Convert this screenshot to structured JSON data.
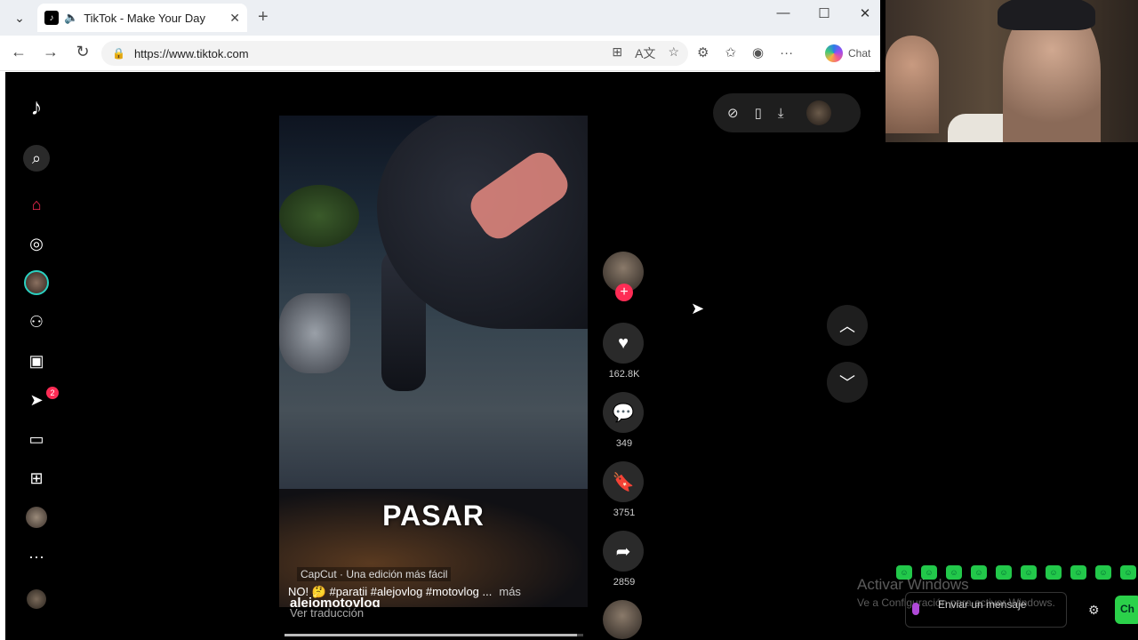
{
  "browser": {
    "tab_title": "TikTok - Make Your Day",
    "url": "https://www.tiktok.com",
    "chat_label": "Chat"
  },
  "sidebar": {
    "items": [
      {
        "name": "search-icon",
        "glyph": "⌕"
      },
      {
        "name": "home-icon",
        "glyph": "⌂"
      },
      {
        "name": "explore-icon",
        "glyph": "◎"
      },
      {
        "name": "following-avatar",
        "glyph": ""
      },
      {
        "name": "friends-icon",
        "glyph": "👥"
      },
      {
        "name": "live-icon",
        "glyph": "▣"
      },
      {
        "name": "messages-icon",
        "glyph": "➤"
      },
      {
        "name": "activity-icon",
        "glyph": "▭"
      },
      {
        "name": "upload-icon",
        "glyph": "⊞"
      },
      {
        "name": "profile-avatar",
        "glyph": ""
      },
      {
        "name": "more-icon",
        "glyph": "···"
      }
    ],
    "messages_badge": "2"
  },
  "video": {
    "caption_overlay": "PASAR",
    "capcut_label": "CapCut · Una edición más fácil",
    "username": "alejomotovlog",
    "description": "NO! 🤔 #paratii #alejovlog #motovlog ...",
    "more_label": "más",
    "translate_label": "Ver traducción",
    "progress_fraction": 0.98
  },
  "actions": {
    "likes": "162.8K",
    "comments": "349",
    "saves": "3751",
    "shares": "2859"
  },
  "stream_chat": {
    "watermark_title": "Activar Windows",
    "watermark_sub": "Ve a Configuración para activar Windows.",
    "input_placeholder": "Enviar un mensaje",
    "send_label": "Ch"
  },
  "colors": {
    "brand_red": "#fe2c55",
    "chat_green": "#2bd14a"
  }
}
